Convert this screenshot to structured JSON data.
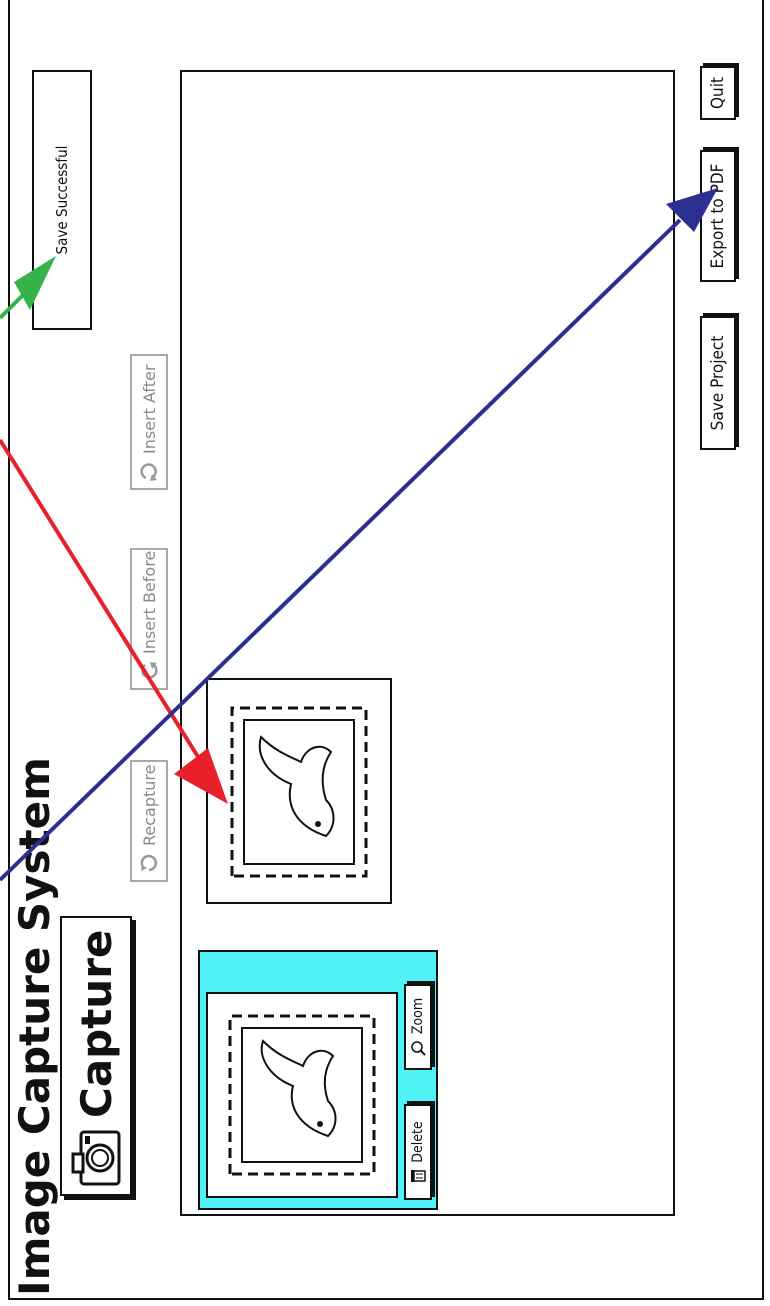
{
  "app": {
    "title": "Image Capture System"
  },
  "capture_button": {
    "label": "Capture"
  },
  "toolbar": {
    "recapture_label": "Recapture",
    "insert_before_label": "Insert Before",
    "insert_after_label": "Insert After"
  },
  "notification": {
    "text": "Save Successful"
  },
  "thumbnail_actions": {
    "delete_label": "Delete",
    "zoom_label": "Zoom"
  },
  "footer": {
    "save_project_label": "Save Project",
    "export_pdf_label": "Export to PDF",
    "quit_label": "Quit"
  },
  "colors": {
    "selected_highlight": "#4ff1f4",
    "arrow_red": "#e8202a",
    "arrow_blue": "#2b2f8f",
    "arrow_green": "#36b24a"
  },
  "icons": [
    "camera-icon",
    "recapture-icon",
    "insert-before-icon",
    "insert-after-icon",
    "trash-icon",
    "magnifier-icon",
    "stamp-bird-image"
  ]
}
